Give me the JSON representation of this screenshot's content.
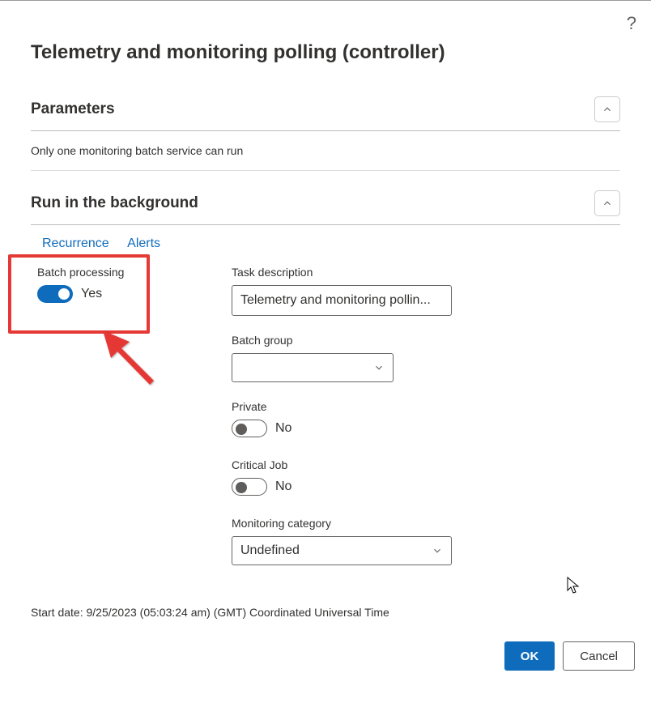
{
  "page_title": "Telemetry and monitoring polling (controller)",
  "sections": {
    "parameters": {
      "title": "Parameters",
      "info": "Only one monitoring batch service can run"
    },
    "background": {
      "title": "Run in the background"
    }
  },
  "links": {
    "recurrence": "Recurrence",
    "alerts": "Alerts"
  },
  "fields": {
    "batch_processing": {
      "label": "Batch processing",
      "value": "Yes"
    },
    "task_description": {
      "label": "Task description",
      "value": "Telemetry and monitoring pollin..."
    },
    "batch_group": {
      "label": "Batch group",
      "value": ""
    },
    "private": {
      "label": "Private",
      "value": "No"
    },
    "critical_job": {
      "label": "Critical Job",
      "value": "No"
    },
    "monitoring_category": {
      "label": "Monitoring category",
      "value": "Undefined"
    }
  },
  "footer": "Start date: 9/25/2023 (05:03:24 am) (GMT) Coordinated Universal Time",
  "buttons": {
    "ok": "OK",
    "cancel": "Cancel"
  }
}
